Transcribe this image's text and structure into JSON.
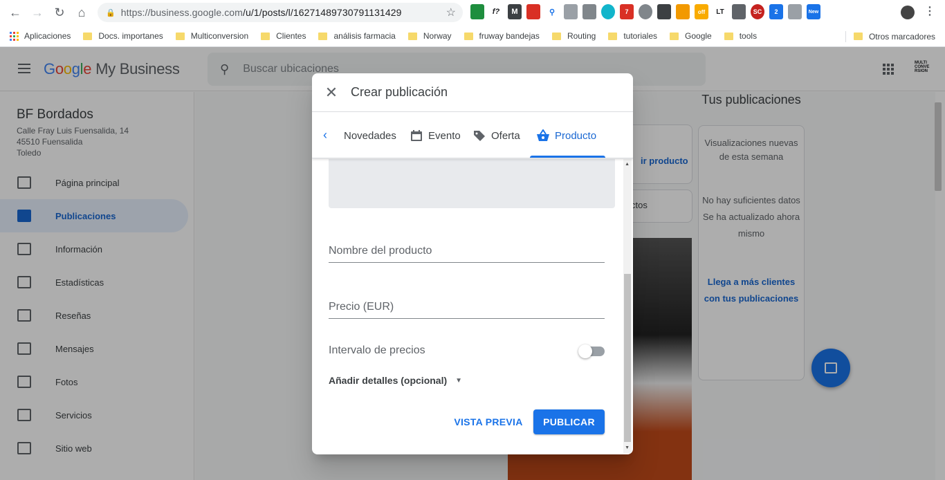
{
  "browser": {
    "url_host": "https://business.google.com",
    "url_path": "/u/1/posts/l/16271489730791131429",
    "bookmarks": [
      "Aplicaciones",
      "Docs. importanes",
      "Multiconversion",
      "Clientes",
      "análisis farmacia",
      "Norway",
      "fruway bandejas",
      "Routing",
      "tutoriales",
      "Google",
      "tools"
    ],
    "other_bookmarks": "Otros marcadores",
    "extension_badges": [
      "7",
      "2",
      "off",
      "New"
    ]
  },
  "app": {
    "logo_google": [
      "G",
      "o",
      "o",
      "g",
      "l",
      "e"
    ],
    "logo_product": "My Business",
    "search_placeholder": "Buscar ubicaciones",
    "account_logo_text": "MULTI CONVE RSION"
  },
  "business": {
    "name": "BF Bordados",
    "address_line1": "Calle Fray Luis Fuensalida, 14",
    "address_line2": "45510 Fuensalida",
    "address_line3": "Toledo"
  },
  "nav": [
    {
      "label": "Página principal",
      "icon": "dashboard-icon"
    },
    {
      "label": "Publicaciones",
      "icon": "posts-icon",
      "active": true
    },
    {
      "label": "Información",
      "icon": "store-icon"
    },
    {
      "label": "Estadísticas",
      "icon": "bar-chart-icon"
    },
    {
      "label": "Reseñas",
      "icon": "review-icon"
    },
    {
      "label": "Mensajes",
      "icon": "message-icon"
    },
    {
      "label": "Fotos",
      "icon": "photo-icon"
    },
    {
      "label": "Servicios",
      "icon": "list-icon"
    },
    {
      "label": "Sitio web",
      "icon": "web-icon"
    }
  ],
  "side_panel": {
    "title": "Tus publicaciones",
    "subtitle": "Visualizaciones nuevas de esta semana",
    "note_line1": "No hay suficientes datos",
    "note_line2": "Se ha actualizado ahora mismo",
    "link": "Llega a más clientes con tus publicaciones",
    "behind_add_product": "ir producto",
    "behind_products": "ctos"
  },
  "dialog": {
    "title": "Crear publicación",
    "tabs": [
      "Novedades",
      "Evento",
      "Oferta",
      "Producto"
    ],
    "active_tab": "Producto",
    "product_name_placeholder": "Nombre del producto",
    "price_placeholder": "Precio (EUR)",
    "price_range_label": "Intervalo de precios",
    "price_range_enabled": false,
    "details_label": "Añadir detalles (opcional)",
    "preview_button": "VISTA PREVIA",
    "publish_button": "PUBLICAR"
  },
  "colors": {
    "accent": "#1a73e8",
    "active_nav_bg": "#e8f0fe"
  }
}
